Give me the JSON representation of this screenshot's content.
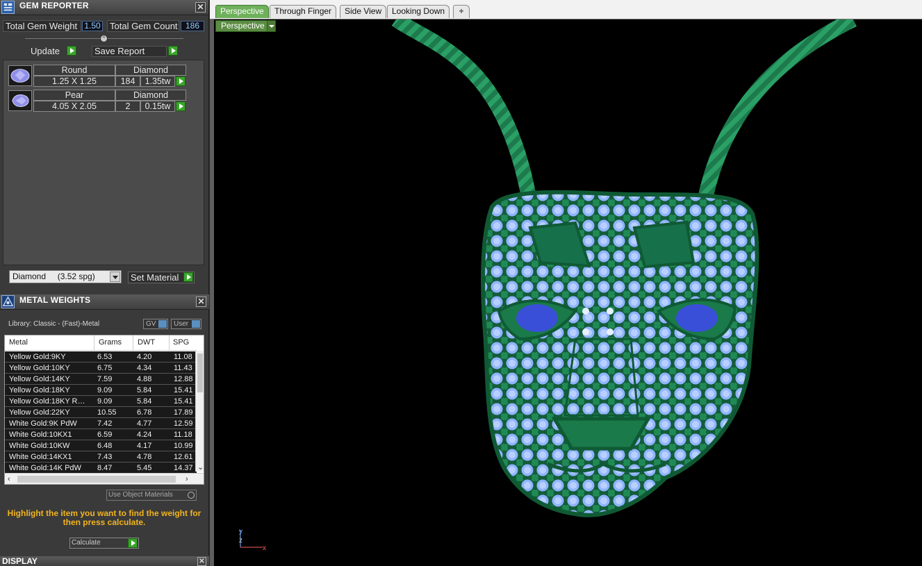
{
  "gem_reporter": {
    "title": "GEM REPORTER",
    "total_weight_label": "Total Gem Weight",
    "total_weight_value": "1.50",
    "total_count_label": "Total Gem Count",
    "total_count_value": "186",
    "update_label": "Update",
    "save_report_label": "Save Report",
    "gems": [
      {
        "shape": "Round",
        "material": "Diamond",
        "size": "1.25 X 1.25",
        "count": "184",
        "weight": "1.35tw"
      },
      {
        "shape": "Pear",
        "material": "Diamond",
        "size": "4.05 X 2.05",
        "count": "2",
        "weight": "0.15tw"
      }
    ],
    "material_select_value": "Diamond     (3.52 spg)",
    "set_material_label": "Set Material"
  },
  "metal_weights": {
    "title": "METAL WEIGHTS",
    "library_label": "Library: Classic - (Fast)-Metal",
    "toggle_gv": "GV",
    "toggle_user": "User",
    "columns": [
      "Metal",
      "Grams",
      "DWT",
      "SPG"
    ],
    "rows": [
      [
        "Yellow Gold:9KY",
        "6.53",
        "4.20",
        "11.08"
      ],
      [
        "Yellow Gold:10KY",
        "6.75",
        "4.34",
        "11.43"
      ],
      [
        "Yellow Gold:14KY",
        "7.59",
        "4.88",
        "12.88"
      ],
      [
        "Yellow Gold:18KY",
        "9.09",
        "5.84",
        "15.41"
      ],
      [
        "Yellow Gold:18KY R…",
        "9.09",
        "5.84",
        "15.41"
      ],
      [
        "Yellow Gold:22KY",
        "10.55",
        "6.78",
        "17.89"
      ],
      [
        "White Gold:9K PdW",
        "7.42",
        "4.77",
        "12.59"
      ],
      [
        "White Gold:10KX1",
        "6.59",
        "4.24",
        "11.18"
      ],
      [
        "White Gold:10KW",
        "6.48",
        "4.17",
        "10.99"
      ],
      [
        "White Gold:14KX1",
        "7.43",
        "4.78",
        "12.61"
      ],
      [
        "White Gold:14K PdW",
        "8.47",
        "5.45",
        "14.37"
      ]
    ],
    "use_object_materials_label": "Use Object Materials",
    "hint_text": "Highlight the item you want to find the weight for then press calculate.",
    "calculate_label": "Calculate"
  },
  "display": {
    "title": "DISPLAY"
  },
  "viewport": {
    "tabs": [
      "Perspective",
      "Through Finger",
      "Side View",
      "Looking Down"
    ],
    "plus_label": "+",
    "view_menu_label": "Perspective",
    "axis_y": "y",
    "axis_z": "z",
    "axis_x": "x"
  },
  "colors": {
    "metal_green": "#1f7a4a",
    "gem_blue": "#8fb4ff",
    "accent_green": "#3aa52c",
    "hint_yellow": "#f2b41f"
  }
}
